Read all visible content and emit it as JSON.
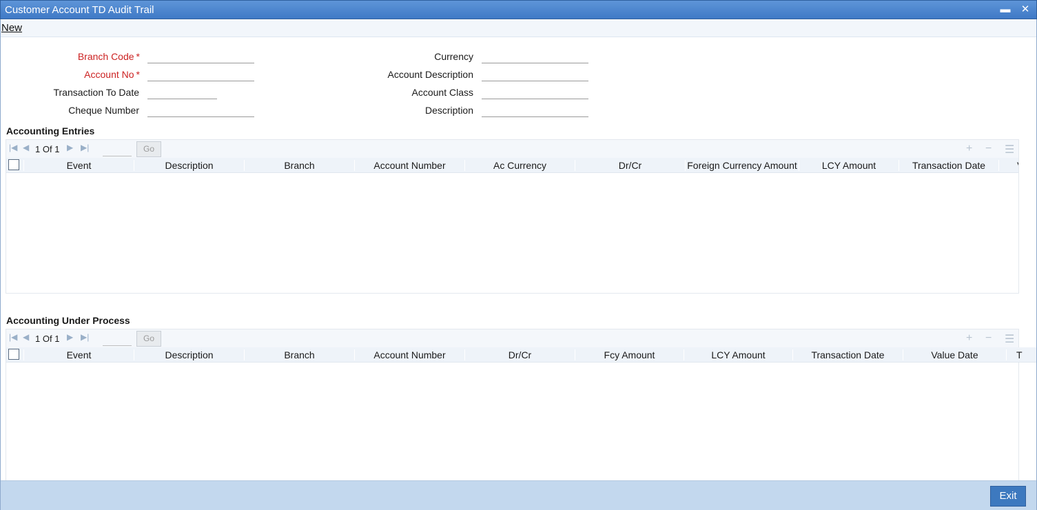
{
  "window": {
    "title": "Customer Account TD Audit Trail",
    "minimize_glyph": "▬",
    "close_glyph": "✕"
  },
  "menu": {
    "new_label": "New"
  },
  "form": {
    "branch_code": {
      "label": "Branch Code",
      "required_mark": "*",
      "value": ""
    },
    "account_no": {
      "label": "Account No",
      "required_mark": "*",
      "value": ""
    },
    "transaction_to_date": {
      "label": "Transaction To Date",
      "value": ""
    },
    "cheque_number": {
      "label": "Cheque Number",
      "value": ""
    },
    "currency": {
      "label": "Currency",
      "value": ""
    },
    "account_description": {
      "label": "Account Description",
      "value": ""
    },
    "account_class": {
      "label": "Account Class",
      "value": ""
    },
    "description": {
      "label": "Description",
      "value": ""
    }
  },
  "accounting_entries": {
    "title": "Accounting Entries",
    "pagination": {
      "current": "1",
      "of_label": "Of",
      "total": "1",
      "go_label": "Go"
    },
    "columns": [
      "Event",
      "Description",
      "Branch",
      "Account Number",
      "Ac Currency",
      "Dr/Cr",
      "Foreign Currency Amount",
      "LCY Amount",
      "Transaction Date",
      "V"
    ],
    "rows": []
  },
  "accounting_under_process": {
    "title": "Accounting Under Process",
    "pagination": {
      "current": "1",
      "of_label": "Of",
      "total": "1",
      "go_label": "Go"
    },
    "columns": [
      "Event",
      "Description",
      "Branch",
      "Account Number",
      "Dr/Cr",
      "Fcy Amount",
      "LCY Amount",
      "Transaction Date",
      "Value Date",
      "T"
    ],
    "rows": []
  },
  "footer": {
    "exit_label": "Exit"
  },
  "icons": {
    "first_page": "first-page-icon",
    "prev_page": "prev-page-icon",
    "next_page": "next-page-icon",
    "last_page": "last-page-icon",
    "add_row": "add-row-icon",
    "delete_row": "delete-row-icon",
    "single_view": "single-record-view-icon"
  },
  "colors": {
    "titlebar": "#4a84cf",
    "required": "#cc2222",
    "footer": "#c3d8ee",
    "exit_button": "#3d79bf"
  }
}
